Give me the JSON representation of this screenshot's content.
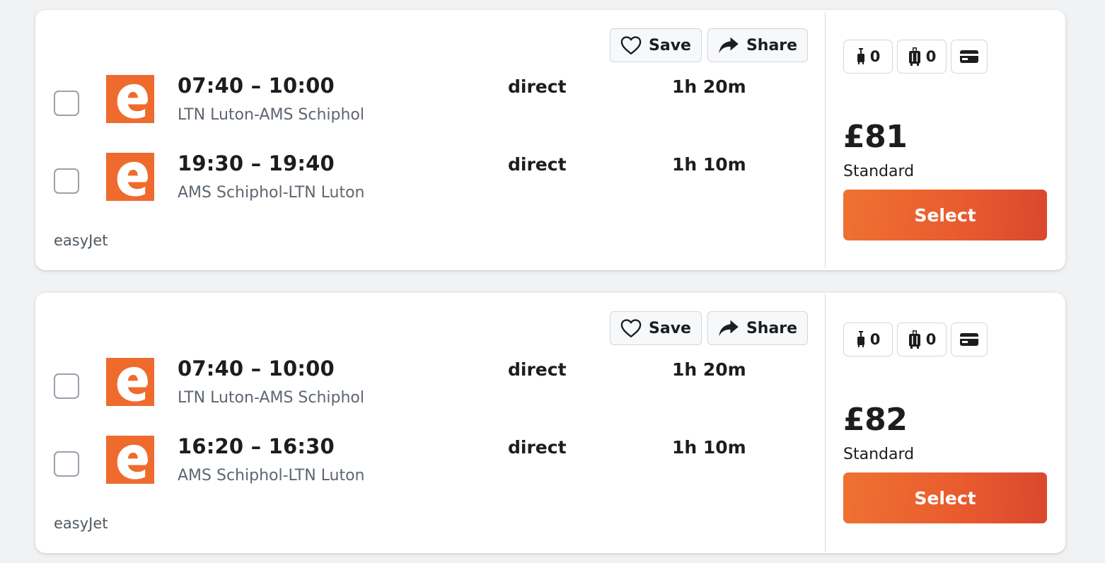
{
  "colors": {
    "brand_orange": "#ee6b2d",
    "select_gradient_start": "#ef7232",
    "select_gradient_end": "#d9472d",
    "page_background": "#f1f2f4"
  },
  "results": [
    {
      "actions": {
        "save_label": "Save",
        "share_label": "Share"
      },
      "legs": [
        {
          "times": "07:40 – 10:00",
          "route": "LTN Luton-AMS Schiphol",
          "stops": "direct",
          "duration": "1h 20m",
          "logo_icon": "easyjet-logo"
        },
        {
          "times": "19:30 – 19:40",
          "route": "AMS Schiphol-LTN Luton",
          "stops": "direct",
          "duration": "1h 10m",
          "logo_icon": "easyjet-logo"
        }
      ],
      "airline": "easyJet",
      "baggage": {
        "personal_item_count": "0",
        "carry_on_count": "0",
        "fare_icon": "card-icon"
      },
      "price": "£81",
      "fare_class": "Standard",
      "select_label": "Select"
    },
    {
      "actions": {
        "save_label": "Save",
        "share_label": "Share"
      },
      "legs": [
        {
          "times": "07:40 – 10:00",
          "route": "LTN Luton-AMS Schiphol",
          "stops": "direct",
          "duration": "1h 20m",
          "logo_icon": "easyjet-logo"
        },
        {
          "times": "16:20 – 16:30",
          "route": "AMS Schiphol-LTN Luton",
          "stops": "direct",
          "duration": "1h 10m",
          "logo_icon": "easyjet-logo"
        }
      ],
      "airline": "easyJet",
      "baggage": {
        "personal_item_count": "0",
        "carry_on_count": "0",
        "fare_icon": "card-icon"
      },
      "price": "£82",
      "fare_class": "Standard",
      "select_label": "Select"
    }
  ]
}
